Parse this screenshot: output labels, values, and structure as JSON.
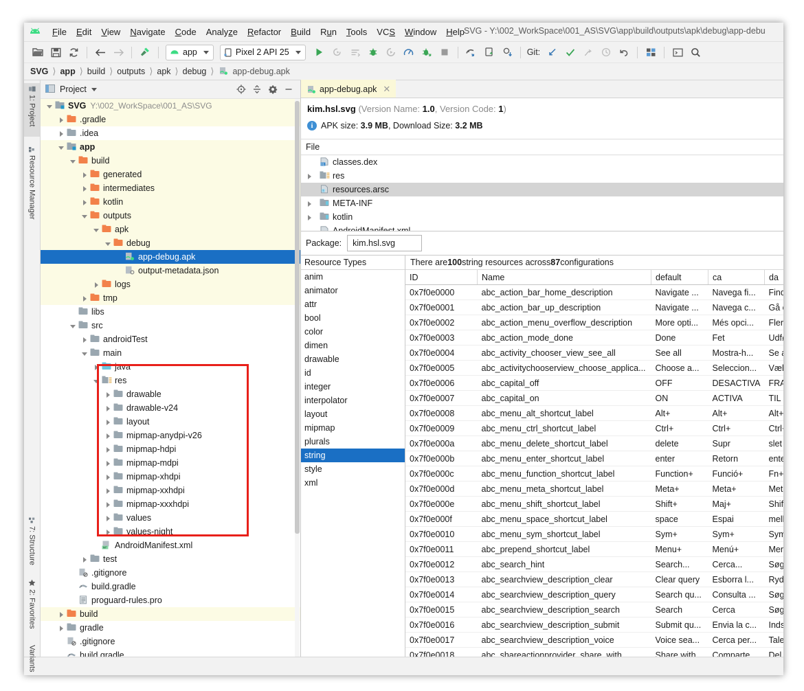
{
  "window": {
    "title": "SVG - Y:\\002_WorkSpace\\001_AS\\SVG\\app\\build\\outputs\\apk\\debug\\app-debu"
  },
  "menu": [
    {
      "label": "File",
      "mnemonic": "F"
    },
    {
      "label": "Edit",
      "mnemonic": "E"
    },
    {
      "label": "View",
      "mnemonic": "V"
    },
    {
      "label": "Navigate",
      "mnemonic": "N"
    },
    {
      "label": "Code",
      "mnemonic": "C"
    },
    {
      "label": "Analyze",
      "mnemonic": "z"
    },
    {
      "label": "Refactor",
      "mnemonic": "R"
    },
    {
      "label": "Build",
      "mnemonic": "B"
    },
    {
      "label": "Run",
      "mnemonic": "R"
    },
    {
      "label": "Tools",
      "mnemonic": "T"
    },
    {
      "label": "VCS",
      "mnemonic": "S"
    },
    {
      "label": "Window",
      "mnemonic": "W"
    },
    {
      "label": "Help",
      "mnemonic": "H"
    }
  ],
  "toolbar": {
    "module_combo": "app",
    "device_combo": "Pixel 2 API 25",
    "git_label": "Git:"
  },
  "breadcrumb": [
    "SVG",
    "app",
    "build",
    "outputs",
    "apk",
    "debug",
    "app-debug.apk"
  ],
  "left_strip": [
    {
      "label": "1: Project",
      "selected": true
    },
    {
      "label": "Resource Manager",
      "selected": false
    }
  ],
  "left_strip_bottom": [
    {
      "label": "7: Structure"
    },
    {
      "label": "2: Favorites"
    },
    {
      "label": "Variants"
    }
  ],
  "project_panel": {
    "title": "Project",
    "tools": [
      "locate-icon",
      "collapse-all-icon",
      "settings-icon",
      "hide-icon"
    ],
    "tree": [
      {
        "indent": 0,
        "tri": "d",
        "icon": "module",
        "label": "SVG",
        "path": "Y:\\002_WorkSpace\\001_AS\\SVG",
        "bold": true,
        "hl": true
      },
      {
        "indent": 1,
        "tri": "r",
        "icon": "orange",
        "label": ".gradle",
        "hl": true
      },
      {
        "indent": 1,
        "tri": "r",
        "icon": "gray",
        "label": ".idea",
        "hl": false
      },
      {
        "indent": 1,
        "tri": "d",
        "icon": "module",
        "label": "app",
        "bold": true,
        "hl": true
      },
      {
        "indent": 2,
        "tri": "d",
        "icon": "orange",
        "label": "build",
        "hl": true
      },
      {
        "indent": 3,
        "tri": "r",
        "icon": "orange",
        "label": "generated",
        "hl": true
      },
      {
        "indent": 3,
        "tri": "r",
        "icon": "orange",
        "label": "intermediates",
        "hl": true
      },
      {
        "indent": 3,
        "tri": "r",
        "icon": "orange",
        "label": "kotlin",
        "hl": true
      },
      {
        "indent": 3,
        "tri": "d",
        "icon": "orange",
        "label": "outputs",
        "hl": true
      },
      {
        "indent": 4,
        "tri": "d",
        "icon": "orange",
        "label": "apk",
        "hl": true
      },
      {
        "indent": 5,
        "tri": "d",
        "icon": "orange",
        "label": "debug",
        "hl": true
      },
      {
        "indent": 6,
        "tri": "none",
        "icon": "apk",
        "label": "app-debug.apk",
        "sel": true
      },
      {
        "indent": 6,
        "tri": "none",
        "icon": "json",
        "label": "output-metadata.json",
        "hl": true
      },
      {
        "indent": 4,
        "tri": "r",
        "icon": "orange",
        "label": "logs",
        "hl": true
      },
      {
        "indent": 3,
        "tri": "r",
        "icon": "orange",
        "label": "tmp",
        "hl": true
      },
      {
        "indent": 2,
        "tri": "none",
        "icon": "gray",
        "label": "libs"
      },
      {
        "indent": 2,
        "tri": "d",
        "icon": "gray",
        "label": "src"
      },
      {
        "indent": 3,
        "tri": "r",
        "icon": "gray",
        "label": "androidTest"
      },
      {
        "indent": 3,
        "tri": "d",
        "icon": "gray",
        "label": "main"
      },
      {
        "indent": 4,
        "tri": "r",
        "icon": "blue",
        "label": "java"
      },
      {
        "indent": 4,
        "tri": "d",
        "icon": "res",
        "label": "res"
      },
      {
        "indent": 5,
        "tri": "r",
        "icon": "gray",
        "label": "drawable"
      },
      {
        "indent": 5,
        "tri": "r",
        "icon": "gray",
        "label": "drawable-v24"
      },
      {
        "indent": 5,
        "tri": "r",
        "icon": "gray",
        "label": "layout"
      },
      {
        "indent": 5,
        "tri": "r",
        "icon": "gray",
        "label": "mipmap-anydpi-v26"
      },
      {
        "indent": 5,
        "tri": "r",
        "icon": "gray",
        "label": "mipmap-hdpi"
      },
      {
        "indent": 5,
        "tri": "r",
        "icon": "gray",
        "label": "mipmap-mdpi"
      },
      {
        "indent": 5,
        "tri": "r",
        "icon": "gray",
        "label": "mipmap-xhdpi"
      },
      {
        "indent": 5,
        "tri": "r",
        "icon": "gray",
        "label": "mipmap-xxhdpi"
      },
      {
        "indent": 5,
        "tri": "r",
        "icon": "gray",
        "label": "mipmap-xxxhdpi"
      },
      {
        "indent": 5,
        "tri": "r",
        "icon": "gray",
        "label": "values"
      },
      {
        "indent": 5,
        "tri": "r",
        "icon": "gray",
        "label": "values-night"
      },
      {
        "indent": 4,
        "tri": "none",
        "icon": "mf",
        "label": "AndroidManifest.xml"
      },
      {
        "indent": 3,
        "tri": "r",
        "icon": "gray",
        "label": "test"
      },
      {
        "indent": 2,
        "tri": "none",
        "icon": "gitignore",
        "label": ".gitignore"
      },
      {
        "indent": 2,
        "tri": "none",
        "icon": "gradle",
        "label": "build.gradle"
      },
      {
        "indent": 2,
        "tri": "none",
        "icon": "pro",
        "label": "proguard-rules.pro"
      },
      {
        "indent": 1,
        "tri": "r",
        "icon": "orange",
        "label": "build",
        "hl": true
      },
      {
        "indent": 1,
        "tri": "r",
        "icon": "gray",
        "label": "gradle"
      },
      {
        "indent": 1,
        "tri": "none",
        "icon": "gitignore",
        "label": ".gitignore"
      },
      {
        "indent": 1,
        "tri": "none",
        "icon": "gradle",
        "label": "build.gradle"
      }
    ],
    "highlight_box_label": "res-folder-highlight"
  },
  "apk_panel": {
    "tab_label": "app-debug.apk",
    "package_name": "kim.hsl.svg",
    "version_name_label": "Version Name:",
    "version_name": "1.0",
    "version_code_label": "Version Code:",
    "version_code": "1",
    "apk_size_label": "APK size:",
    "apk_size": "3.9 MB",
    "download_size_label": "Download Size:",
    "download_size": "3.2 MB",
    "file_column_header": "File",
    "files": [
      {
        "label": "classes.dex",
        "icon": "dex",
        "expandable": false,
        "selected": false
      },
      {
        "label": "res",
        "icon": "res",
        "expandable": true,
        "selected": false
      },
      {
        "label": "resources.arsc",
        "icon": "arsc",
        "expandable": false,
        "selected": true
      },
      {
        "label": "META-INF",
        "icon": "folder",
        "expandable": true,
        "selected": false
      },
      {
        "label": "kotlin",
        "icon": "folder",
        "expandable": true,
        "selected": false
      },
      {
        "label": "AndroidManifest.xml",
        "icon": "manifest",
        "expandable": false,
        "selected": false
      }
    ],
    "package_field_label": "Package:",
    "package_value": "kim.hsl.svg",
    "resource_types_header": "Resource Types",
    "resource_types": [
      "anim",
      "animator",
      "attr",
      "bool",
      "color",
      "dimen",
      "drawable",
      "id",
      "integer",
      "interpolator",
      "layout",
      "mipmap",
      "plurals",
      "string",
      "style",
      "xml"
    ],
    "resource_types_selected": "string",
    "summary_prefix": "There are ",
    "summary_count": "100",
    "summary_mid": " string resources across ",
    "summary_configs": "87",
    "summary_suffix": " configurations",
    "table": {
      "columns": [
        "ID",
        "Name",
        "default",
        "ca",
        "da"
      ],
      "rows": [
        [
          "0x7f0e0000",
          "abc_action_bar_home_description",
          "Navigate ...",
          "Navega fi...",
          "Find hjem"
        ],
        [
          "0x7f0e0001",
          "abc_action_bar_up_description",
          "Navigate ...",
          "Navega c...",
          "Gå op"
        ],
        [
          "0x7f0e0002",
          "abc_action_menu_overflow_description",
          "More opti...",
          "Més opci...",
          "Flere valg..."
        ],
        [
          "0x7f0e0003",
          "abc_action_mode_done",
          "Done",
          "Fet",
          "Udfør"
        ],
        [
          "0x7f0e0004",
          "abc_activity_chooser_view_see_all",
          "See all",
          "Mostra-h...",
          "Se alle"
        ],
        [
          "0x7f0e0005",
          "abc_activitychooserview_choose_applica...",
          "Choose a...",
          "Seleccion...",
          "Vælg en a..."
        ],
        [
          "0x7f0e0006",
          "abc_capital_off",
          "OFF",
          "DESACTIVA",
          "FRA"
        ],
        [
          "0x7f0e0007",
          "abc_capital_on",
          "ON",
          "ACTIVA",
          "TIL"
        ],
        [
          "0x7f0e0008",
          "abc_menu_alt_shortcut_label",
          "Alt+",
          "Alt+",
          "Alt+"
        ],
        [
          "0x7f0e0009",
          "abc_menu_ctrl_shortcut_label",
          "Ctrl+",
          "Ctrl+",
          "Ctrl+"
        ],
        [
          "0x7f0e000a",
          "abc_menu_delete_shortcut_label",
          "delete",
          "Supr",
          "slet"
        ],
        [
          "0x7f0e000b",
          "abc_menu_enter_shortcut_label",
          "enter",
          "Retorn",
          "enter"
        ],
        [
          "0x7f0e000c",
          "abc_menu_function_shortcut_label",
          "Function+",
          "Funció+",
          "Fn+"
        ],
        [
          "0x7f0e000d",
          "abc_menu_meta_shortcut_label",
          "Meta+",
          "Meta+",
          "Meta+"
        ],
        [
          "0x7f0e000e",
          "abc_menu_shift_shortcut_label",
          "Shift+",
          "Maj+",
          "Shift+"
        ],
        [
          "0x7f0e000f",
          "abc_menu_space_shortcut_label",
          "space",
          "Espai",
          "mellemrum"
        ],
        [
          "0x7f0e0010",
          "abc_menu_sym_shortcut_label",
          "Sym+",
          "Sym+",
          "Sym+"
        ],
        [
          "0x7f0e0011",
          "abc_prepend_shortcut_label",
          "Menu+",
          "Menú+",
          "Menu+"
        ],
        [
          "0x7f0e0012",
          "abc_search_hint",
          "Search...",
          "Cerca...",
          "Søg..."
        ],
        [
          "0x7f0e0013",
          "abc_searchview_description_clear",
          "Clear query",
          "Esborra l...",
          "Ryd fores..."
        ],
        [
          "0x7f0e0014",
          "abc_searchview_description_query",
          "Search qu...",
          "Consulta ...",
          "Søgefore..."
        ],
        [
          "0x7f0e0015",
          "abc_searchview_description_search",
          "Search",
          "Cerca",
          "Søg"
        ],
        [
          "0x7f0e0016",
          "abc_searchview_description_submit",
          "Submit qu...",
          "Envia la c...",
          "Indsend f..."
        ],
        [
          "0x7f0e0017",
          "abc_searchview_description_voice",
          "Voice sea...",
          "Cerca per...",
          "Talesøgni..."
        ],
        [
          "0x7f0e0018",
          "abc_shareactionprovider_share_with",
          "Share with",
          "Comparte...",
          "Del med"
        ]
      ]
    }
  },
  "colors": {
    "accent_selection": "#1a6fc4",
    "highlight_row": "#fcfbe4",
    "android_green": "#3ddc84",
    "folder_orange": "#f2814a",
    "folder_gray": "#9aa7b0",
    "red_annotation": "#e8201a"
  }
}
